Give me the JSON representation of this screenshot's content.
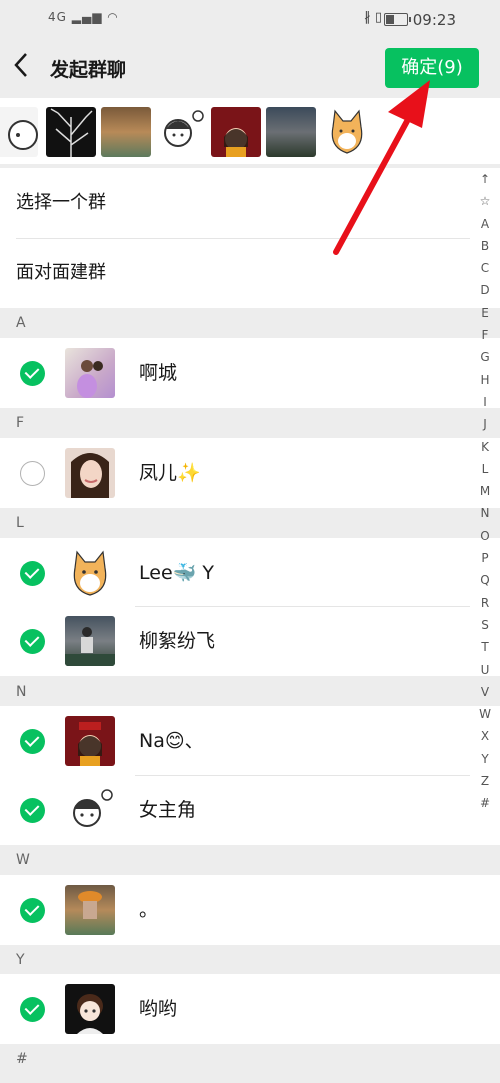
{
  "statusbar": {
    "network": "4G",
    "time": "09:23",
    "icons_text": "∦ ▯"
  },
  "header": {
    "back_icon": "chevron-left-icon",
    "title": "发起群聊",
    "confirm_label": "确定(9)"
  },
  "menu": {
    "items": [
      "选择一个群",
      "面对面建群"
    ]
  },
  "index_letters": [
    "↑",
    "☆",
    "A",
    "B",
    "C",
    "D",
    "E",
    "F",
    "G",
    "H",
    "I",
    "J",
    "K",
    "L",
    "M",
    "N",
    "O",
    "P",
    "Q",
    "R",
    "S",
    "T",
    "U",
    "V",
    "W",
    "X",
    "Y",
    "Z",
    "#"
  ],
  "groups": [
    {
      "letter": "A",
      "contacts": [
        {
          "name": "啊城",
          "checked": true
        }
      ]
    },
    {
      "letter": "F",
      "contacts": [
        {
          "name": "凤儿✨",
          "checked": false
        }
      ]
    },
    {
      "letter": "L",
      "contacts": [
        {
          "name": "Lee🐳 Y",
          "checked": true
        },
        {
          "name": "柳絮纷飞",
          "checked": true
        }
      ]
    },
    {
      "letter": "N",
      "contacts": [
        {
          "name": "Na😊、",
          "checked": true
        },
        {
          "name": "女主角",
          "checked": true
        }
      ]
    },
    {
      "letter": "W",
      "contacts": [
        {
          "name": "。",
          "checked": true
        }
      ]
    },
    {
      "letter": "Y",
      "contacts": [
        {
          "name": "哟哟",
          "checked": true
        }
      ]
    },
    {
      "letter": "#",
      "contacts": []
    }
  ],
  "colors": {
    "accent": "#07c160",
    "annotation": "#e8101a"
  }
}
